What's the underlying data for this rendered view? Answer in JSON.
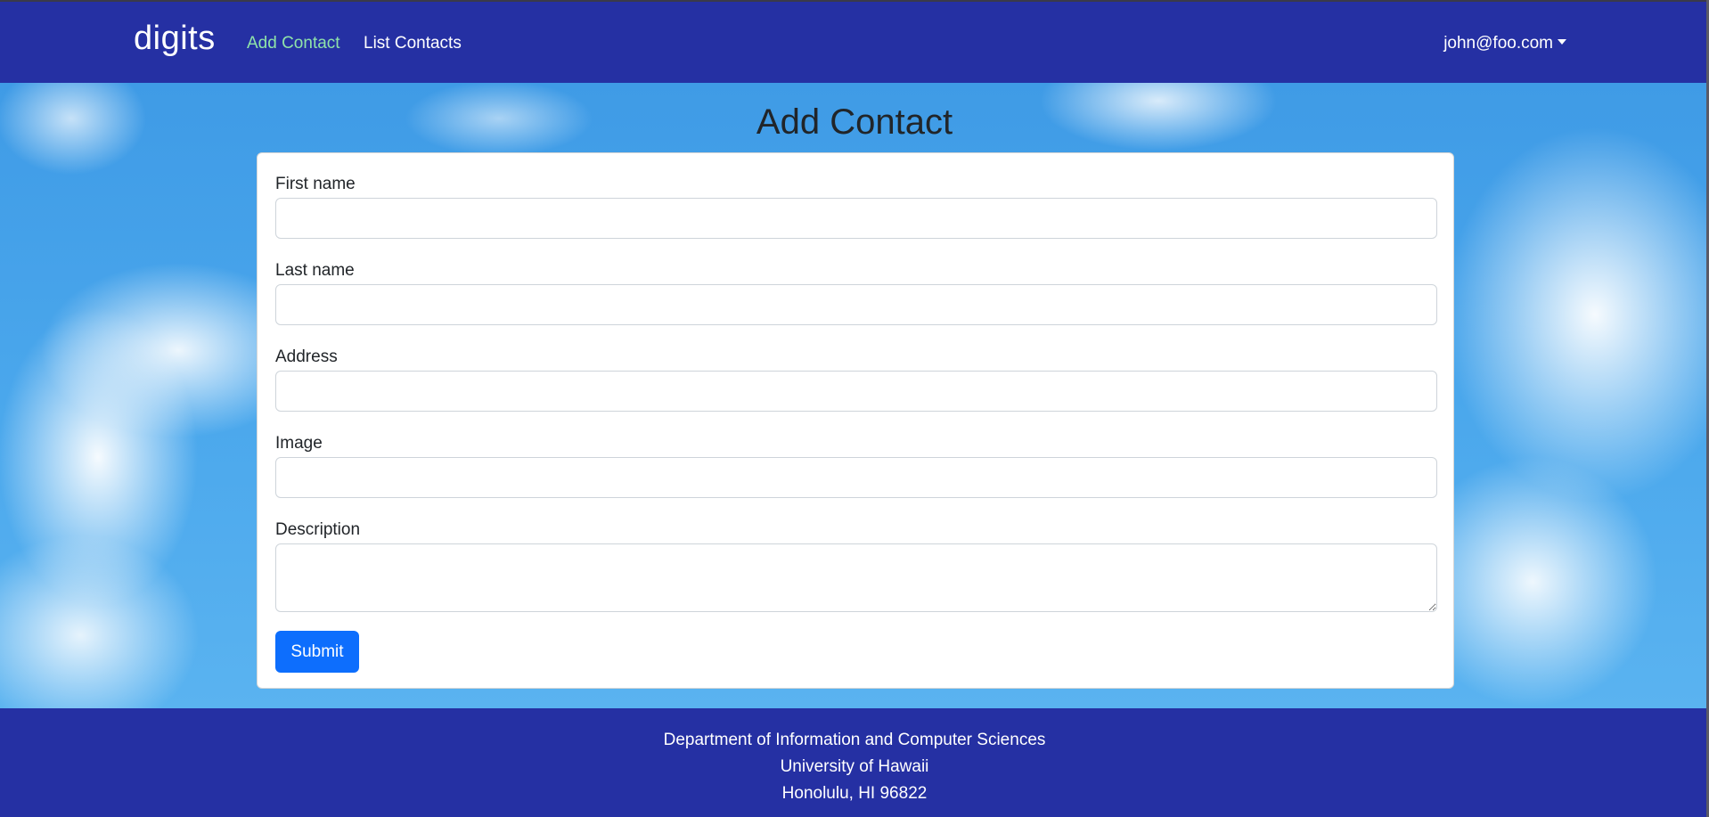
{
  "navbar": {
    "brand": "digits",
    "links": [
      {
        "label": "Add Contact",
        "active": true
      },
      {
        "label": "List Contacts",
        "active": false
      }
    ],
    "user": "john@foo.com"
  },
  "page": {
    "title": "Add Contact"
  },
  "form": {
    "fields": [
      {
        "label": "First name",
        "value": ""
      },
      {
        "label": "Last name",
        "value": ""
      },
      {
        "label": "Address",
        "value": ""
      },
      {
        "label": "Image",
        "value": ""
      },
      {
        "label": "Description",
        "value": ""
      }
    ],
    "submit_label": "Submit"
  },
  "footer": {
    "lines": [
      "Department of Information and Computer Sciences",
      "University of Hawaii",
      "Honolulu, HI 96822"
    ]
  },
  "colors": {
    "navbar": "#2530a3",
    "active_link": "#8fe3a9",
    "submit": "#0d6efd"
  }
}
